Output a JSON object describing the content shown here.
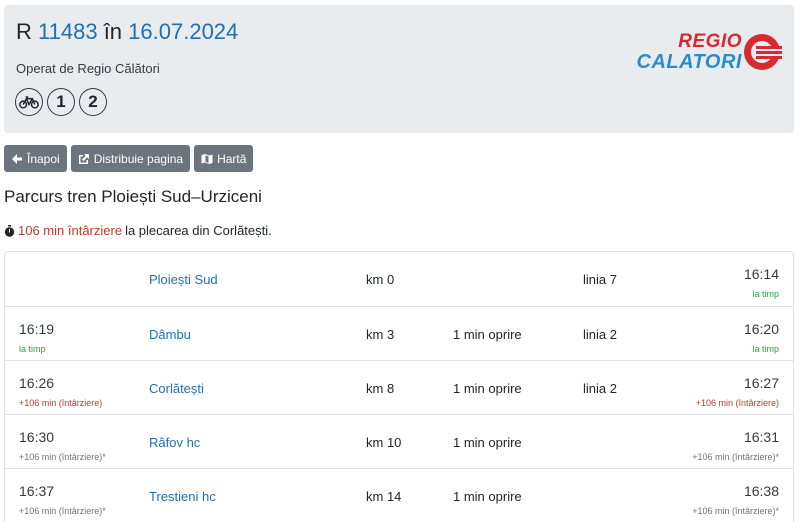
{
  "header": {
    "train_prefix": "R",
    "train_number": "11483",
    "date_prefix": "în",
    "date": "16.07.2024",
    "operator": "Operat de Regio Călători",
    "badges": [
      "1",
      "2"
    ],
    "logo_top": "REGIO",
    "logo_bottom": "CALATORI"
  },
  "toolbar": {
    "back": "Înapoi",
    "share": "Distribuie pagina",
    "map": "Hartă"
  },
  "route_title": "Parcurs tren Ploiești Sud–Urziceni",
  "delay_notice": {
    "delay": "106 min întârziere",
    "rest": "la plecarea din Corlătești."
  },
  "stations": [
    {
      "arr_time": "",
      "arr_note": "",
      "arr_status": "",
      "name": "Ploiești Sud",
      "km": "km 0",
      "stop": "",
      "line": "linia 7",
      "dep_time": "16:14",
      "dep_note": "la timp",
      "dep_status": "ontime"
    },
    {
      "arr_time": "16:19",
      "arr_note": "la timp",
      "arr_status": "ontime",
      "name": "Dâmbu",
      "km": "km 3",
      "stop": "1 min oprire",
      "line": "linia 2",
      "dep_time": "16:20",
      "dep_note": "la timp",
      "dep_status": "ontime"
    },
    {
      "arr_time": "16:26",
      "arr_note": "+106 min (întârziere)",
      "arr_status": "late",
      "name": "Corlătești",
      "km": "km 8",
      "stop": "1 min oprire",
      "line": "linia 2",
      "dep_time": "16:27",
      "dep_note": "+106 min (întârziere)",
      "dep_status": "late"
    },
    {
      "arr_time": "16:30",
      "arr_note": "+106 min (întârziere)*",
      "arr_status": "est",
      "name": "Râfov hc",
      "km": "km 10",
      "stop": "1 min oprire",
      "line": "",
      "dep_time": "16:31",
      "dep_note": "+106 min (întârziere)*",
      "dep_status": "est"
    },
    {
      "arr_time": "16:37",
      "arr_note": "+106 min (întârziere)*",
      "arr_status": "est",
      "name": "Trestieni hc",
      "km": "km 14",
      "stop": "1 min oprire",
      "line": "",
      "dep_time": "16:38",
      "dep_note": "+106 min (întârziere)*",
      "dep_status": "est"
    }
  ],
  "colors": {
    "link": "#1f6fb5",
    "ontime": "#28a745",
    "late": "#c0392b",
    "estimated": "#6c757d",
    "button": "#6c757d"
  }
}
